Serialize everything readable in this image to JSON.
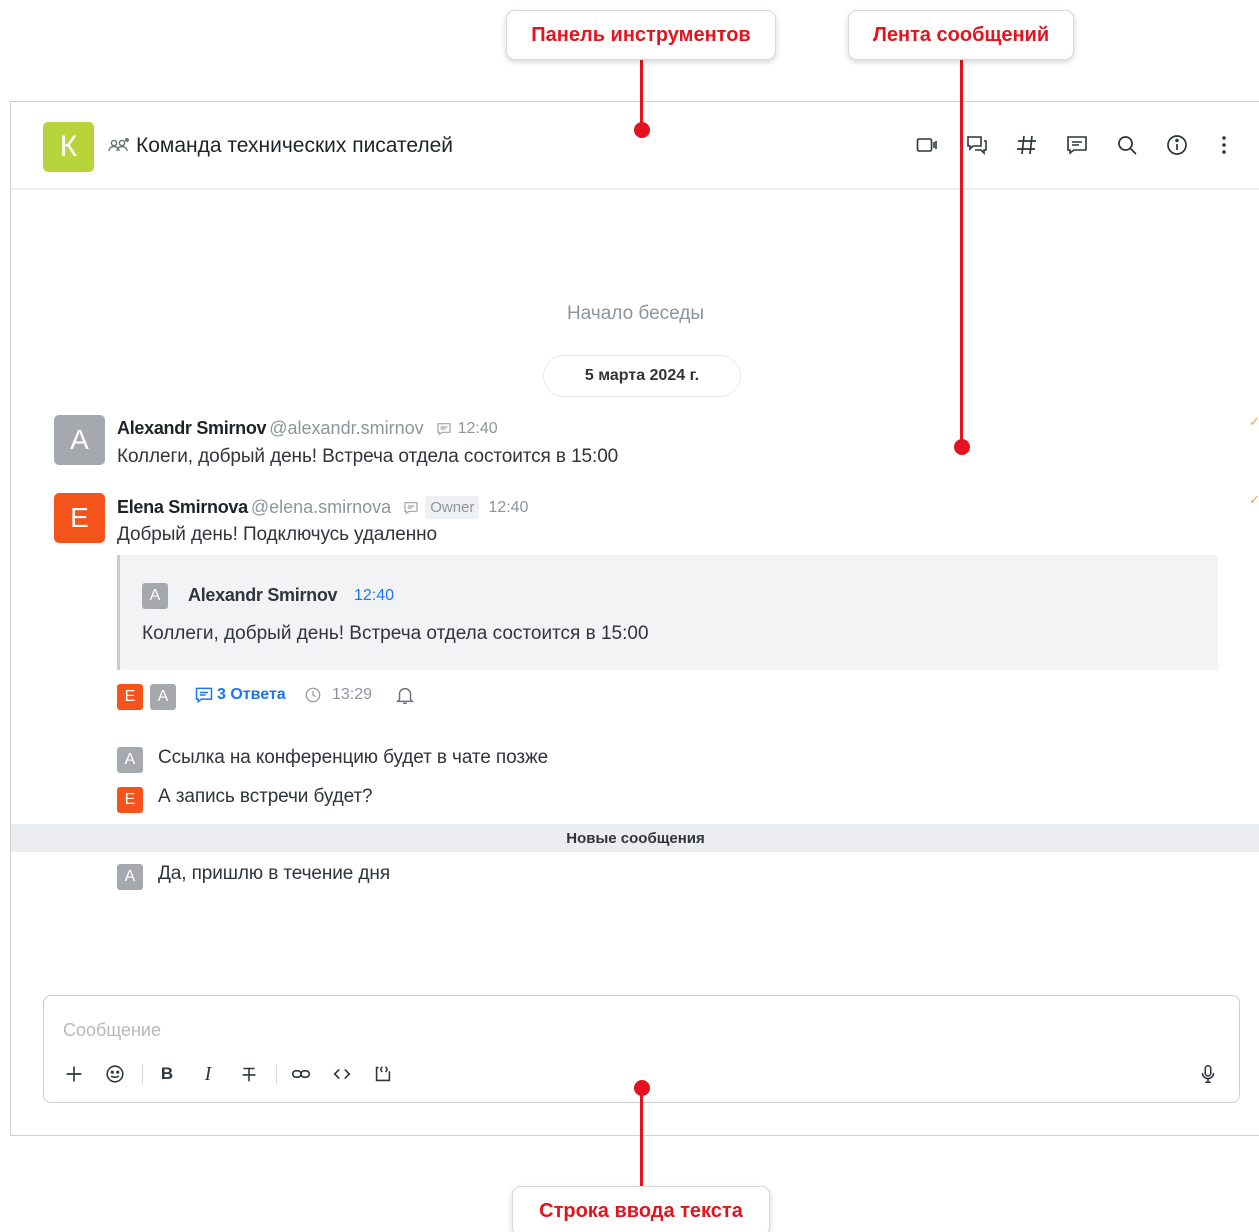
{
  "callouts": {
    "toolbar": "Панель инструментов",
    "feed": "Лента сообщений",
    "input": "Строка ввода текста"
  },
  "header": {
    "avatar_letter": "К",
    "title": "Команда технических писателей",
    "avatar_color": "#b7d53a",
    "icons": [
      "video-call-icon",
      "discussion-icon",
      "channels-hash-icon",
      "threads-icon",
      "search-icon",
      "info-icon",
      "kebab-menu-icon"
    ]
  },
  "feed": {
    "start_label": "Начало беседы",
    "date_label": "5 марта 2024 г.",
    "new_messages_label": "Новые сообщения",
    "messages": [
      {
        "avatar": "A",
        "name": "Alexandr Smirnov",
        "handle": "@alexandr.smirnov",
        "time": "12:40",
        "text": "Коллеги, добрый день! Встреча отдела состоится в 15:00"
      },
      {
        "avatar": "E",
        "name": "Elena Smirnova",
        "handle": "@elena.smirnova",
        "role": "Owner",
        "time": "12:40",
        "text": "Добрый день! Подключусь удаленно",
        "quote": {
          "avatar": "A",
          "name": "Alexandr Smirnov",
          "time": "12:40",
          "text": "Коллеги, добрый день! Встреча отдела состоится в 15:00"
        },
        "thread": {
          "participants": [
            "E",
            "A"
          ],
          "replies_label": "3 Ответа",
          "last_reply_time": "13:29"
        }
      }
    ],
    "sequential": [
      {
        "avatar": "A",
        "text": "Ссылка на конференцию будет в чате позже"
      },
      {
        "avatar": "E",
        "text": "А запись встречи будет?"
      }
    ],
    "after_new": [
      {
        "avatar": "A",
        "text": "Да, пришлю в течение дня"
      }
    ],
    "colors": {
      "user_a": "#a5a8ad",
      "user_e": "#f4541c",
      "link": "#1d74f5"
    }
  },
  "composer": {
    "placeholder": "Сообщение",
    "value": "",
    "tools": [
      "plus-icon",
      "emoji-icon",
      "bold-icon",
      "italic-icon",
      "strikethrough-icon",
      "link-icon",
      "code-icon",
      "code-block-icon",
      "microphone-icon"
    ],
    "bold_label": "B",
    "italic_label": "I"
  }
}
